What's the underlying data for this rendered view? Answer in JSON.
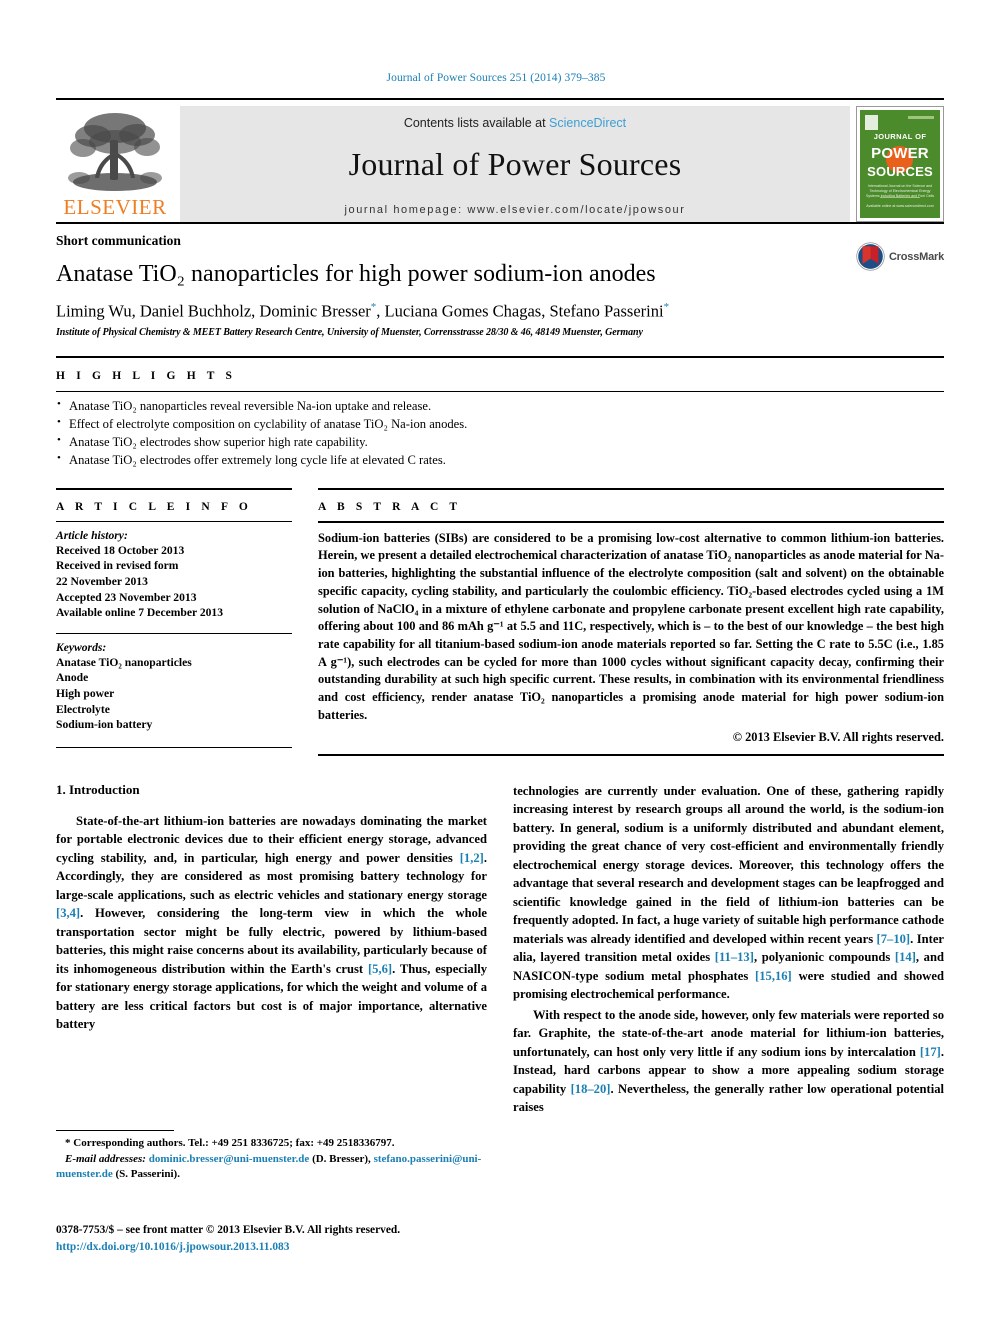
{
  "running_head": "Journal of Power Sources 251 (2014) 379–385",
  "masthead": {
    "contents_prefix": "Contents lists available at ",
    "sciencedirect": "ScienceDirect",
    "journal_title": "Journal of Power Sources",
    "homepage": "journal homepage: www.elsevier.com/locate/jpowsour",
    "publisher_logo_text": "ELSEVIER",
    "cover": {
      "line1": "JOURNAL OF",
      "line2": "POWER",
      "line3": "SOURCES",
      "subtitle": "International Journal on the Science and Technology of Electrochemical Energy Systems including Batteries and Fuel Cells",
      "footer": "Available online at www.sciencedirect.com"
    },
    "accent_link_color": "#3c9fd4",
    "cover_green": "#4c8b2b",
    "cover_orange": "#e8601c",
    "elsevier_orange": "#ef7d22"
  },
  "article": {
    "doctype": "Short communication",
    "title": "Anatase TiO₂ nanoparticles for high power sodium-ion anodes",
    "authors": "Liming Wu, Daniel Buchholz, Dominic Bresser",
    "authors_after_star": ", Luciana Gomes Chagas, Stefano Passerini",
    "corresponding_mark": "*",
    "affiliation": "Institute of Physical Chemistry & MEET Battery Research Centre, University of Muenster, Corrensstrasse 28/30 & 46, 48149 Muenster, Germany",
    "crossmark_label": "CrossMark"
  },
  "highlights": {
    "heading": "H I G H L I G H T S",
    "items": [
      "Anatase TiO₂ nanoparticles reveal reversible Na-ion uptake and release.",
      "Effect of electrolyte composition on cyclability of anatase TiO₂ Na-ion anodes.",
      "Anatase TiO₂ electrodes show superior high rate capability.",
      "Anatase TiO₂ electrodes offer extremely long cycle life at elevated C rates."
    ]
  },
  "article_info": {
    "heading": "A R T I C L E   I N F O",
    "history_label": "Article history:",
    "history": [
      "Received 18 October 2013",
      "Received in revised form",
      "22 November 2013",
      "Accepted 23 November 2013",
      "Available online 7 December 2013"
    ],
    "keywords_label": "Keywords:",
    "keywords": [
      "Anatase TiO₂ nanoparticles",
      "Anode",
      "High power",
      "Electrolyte",
      "Sodium-ion battery"
    ]
  },
  "abstract": {
    "heading": "A B S T R A C T",
    "text": "Sodium-ion batteries (SIBs) are considered to be a promising low-cost alternative to common lithium-ion batteries. Herein, we present a detailed electrochemical characterization of anatase TiO₂ nanoparticles as anode material for Na-ion batteries, highlighting the substantial influence of the electrolyte composition (salt and solvent) on the obtainable specific capacity, cycling stability, and particularly the coulombic efficiency. TiO₂-based electrodes cycled using a 1M solution of NaClO₄ in a mixture of ethylene carbonate and propylene carbonate present excellent high rate capability, offering about 100 and 86 mAh g⁻¹ at 5.5 and 11C, respectively, which is – to the best of our knowledge – the best high rate capability for all titanium-based sodium-ion anode materials reported so far. Setting the C rate to 5.5C (i.e., 1.85 A g⁻¹), such electrodes can be cycled for more than 1000 cycles without significant capacity decay, confirming their outstanding durability at such high specific current. These results, in combination with its environmental friendliness and cost efficiency, render anatase TiO₂ nanoparticles a promising anode material for high power sodium-ion batteries.",
    "copyright": "© 2013 Elsevier B.V. All rights reserved."
  },
  "introduction": {
    "section_number_title": "1.  Introduction",
    "left_para_1_a": "State-of-the-art lithium-ion batteries are nowadays dominating the market for portable electronic devices due to their efficient energy storage, advanced cycling stability, and, in particular, high energy and power densities ",
    "left_ref_1": "[1,2]",
    "left_para_1_b": ". Accordingly, they are considered as most promising battery technology for large-scale applications, such as electric vehicles and stationary energy storage ",
    "left_ref_2": "[3,4]",
    "left_para_1_c": ". However, considering the long-term view in which the whole transportation sector might be fully electric, powered by lithium-based batteries, this might raise concerns about its availability, particularly because of its inhomogeneous distribution within the Earth's crust ",
    "left_ref_3": "[5,6]",
    "left_para_1_d": ". Thus, especially for stationary energy storage applications, for which the weight and volume of a battery are less critical factors but cost is of major importance, alternative battery",
    "right_para_1_a": "technologies are currently under evaluation. One of these, gathering rapidly increasing interest by research groups all around the world, is the sodium-ion battery. In general, sodium is a uniformly distributed and abundant element, providing the great chance of very cost-efficient and environmentally friendly electrochemical energy storage devices. Moreover, this technology offers the advantage that several research and development stages can be leapfrogged and scientific knowledge gained in the field of lithium-ion batteries can be frequently adopted. In fact, a huge variety of suitable high performance cathode materials was already identified and developed within recent years ",
    "right_ref_1": "[7–10]",
    "right_para_1_b": ". Inter alia, layered transition metal oxides ",
    "right_ref_2": "[11–13]",
    "right_para_1_c": ", polyanionic compounds ",
    "right_ref_3": "[14]",
    "right_para_1_d": ", and NASICON-type sodium metal phosphates ",
    "right_ref_4": "[15,16]",
    "right_para_1_e": " were studied and showed promising electrochemical performance.",
    "right_para_2_a": "With respect to the anode side, however, only few materials were reported so far. Graphite, the state-of-the-art anode material for lithium-ion batteries, unfortunately, can host only very little if any sodium ions by intercalation ",
    "right_ref_5": "[17]",
    "right_para_2_b": ". Instead, hard carbons appear to show a more appealing sodium storage capability ",
    "right_ref_6": "[18–20]",
    "right_para_2_c": ". Nevertheless, the generally rather low operational potential raises"
  },
  "footnotes": {
    "corresponding": "* Corresponding authors. Tel.: +49 251 8336725; fax: +49 2518336797.",
    "email_label": "E-mail addresses:",
    "email_1": "dominic.bresser@uni-muenster.de",
    "email_1_name": " (D. Bresser), ",
    "email_2": "stefano.passerini@uni-muenster.de",
    "email_2_name": " (S. Passerini)."
  },
  "imprint": {
    "issn_line": "0378-7753/$ – see front matter © 2013 Elsevier B.V. All rights reserved.",
    "doi": "http://dx.doi.org/10.1016/j.jpowsour.2013.11.083"
  }
}
